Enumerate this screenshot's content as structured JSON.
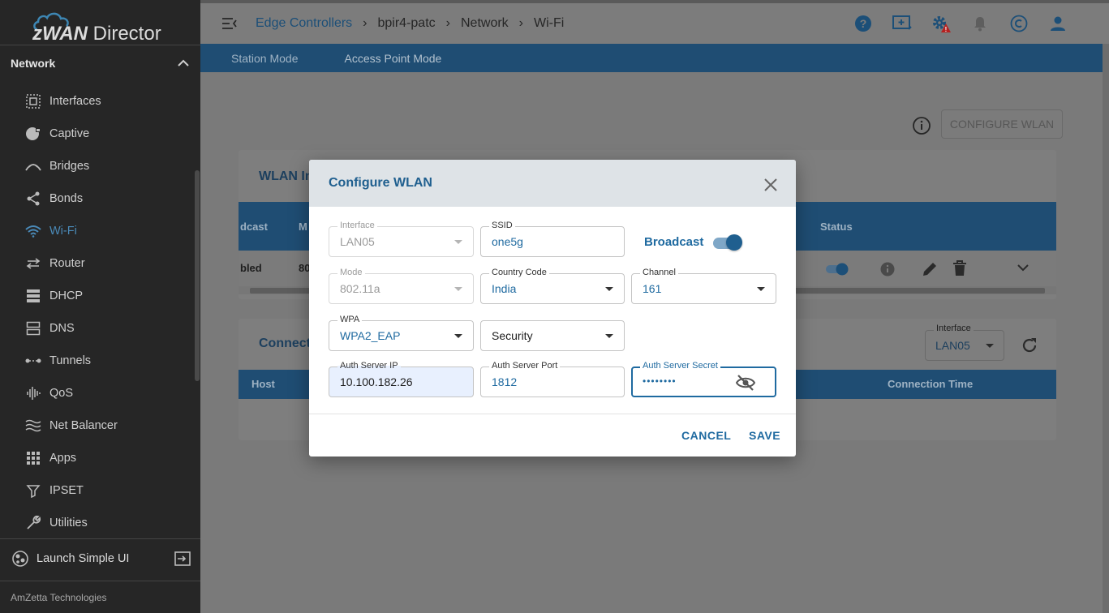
{
  "app": {
    "brand_prefix": "zWAN",
    "brand_suffix": " Director",
    "company": "AmZetta Technologies",
    "launch_label": "Launch Simple UI"
  },
  "sidebar": {
    "section": "Network",
    "items": [
      {
        "label": "Interfaces",
        "icon": "interfaces-icon"
      },
      {
        "label": "Captive",
        "icon": "captive-icon"
      },
      {
        "label": "Bridges",
        "icon": "bridges-icon"
      },
      {
        "label": "Bonds",
        "icon": "bonds-icon"
      },
      {
        "label": "Wi-Fi",
        "icon": "wifi-icon",
        "active": true
      },
      {
        "label": "Router",
        "icon": "router-icon"
      },
      {
        "label": "DHCP",
        "icon": "dhcp-icon"
      },
      {
        "label": "DNS",
        "icon": "dns-icon"
      },
      {
        "label": "Tunnels",
        "icon": "tunnels-icon"
      },
      {
        "label": "QoS",
        "icon": "qos-icon"
      },
      {
        "label": "Net Balancer",
        "icon": "net-balancer-icon"
      },
      {
        "label": "Apps",
        "icon": "apps-icon"
      },
      {
        "label": "IPSET",
        "icon": "ipset-icon"
      },
      {
        "label": "Utilities",
        "icon": "utilities-icon"
      }
    ]
  },
  "breadcrumb": [
    "Edge Controllers",
    "bpir4-patc",
    "Network",
    "Wi-Fi"
  ],
  "tabs": [
    "Station Mode",
    "Access Point Mode"
  ],
  "configure_wlan_button": "CONFIGURE WLAN",
  "wlan_card": {
    "title": "WLAN In",
    "columns": [
      "dcast",
      "M",
      "Status"
    ],
    "row": [
      "bled",
      "80"
    ]
  },
  "connected_card": {
    "title": "Connecte",
    "interface_label": "Interface",
    "interface_value": "LAN05",
    "columns": [
      "Host",
      "Connection Time"
    ]
  },
  "modal": {
    "title": "Configure WLAN",
    "interface": {
      "label": "Interface",
      "value": "LAN05"
    },
    "ssid": {
      "label": "SSID",
      "value": "one5g"
    },
    "broadcast_label": "Broadcast",
    "broadcast_on": true,
    "mode": {
      "label": "Mode",
      "value": "802.11a"
    },
    "country": {
      "label": "Country Code",
      "value": "India"
    },
    "channel": {
      "label": "Channel",
      "value": "161"
    },
    "wpa": {
      "label": "WPA",
      "value": "WPA2_EAP"
    },
    "security": {
      "value": "Security"
    },
    "auth_ip": {
      "label": "Auth Server IP",
      "value": "10.100.182.26"
    },
    "auth_port": {
      "label": "Auth Server Port",
      "value": "1812"
    },
    "auth_secret": {
      "label": "Auth Server Secret",
      "value": "••••••••"
    },
    "cancel": "CANCEL",
    "save": "SAVE"
  }
}
